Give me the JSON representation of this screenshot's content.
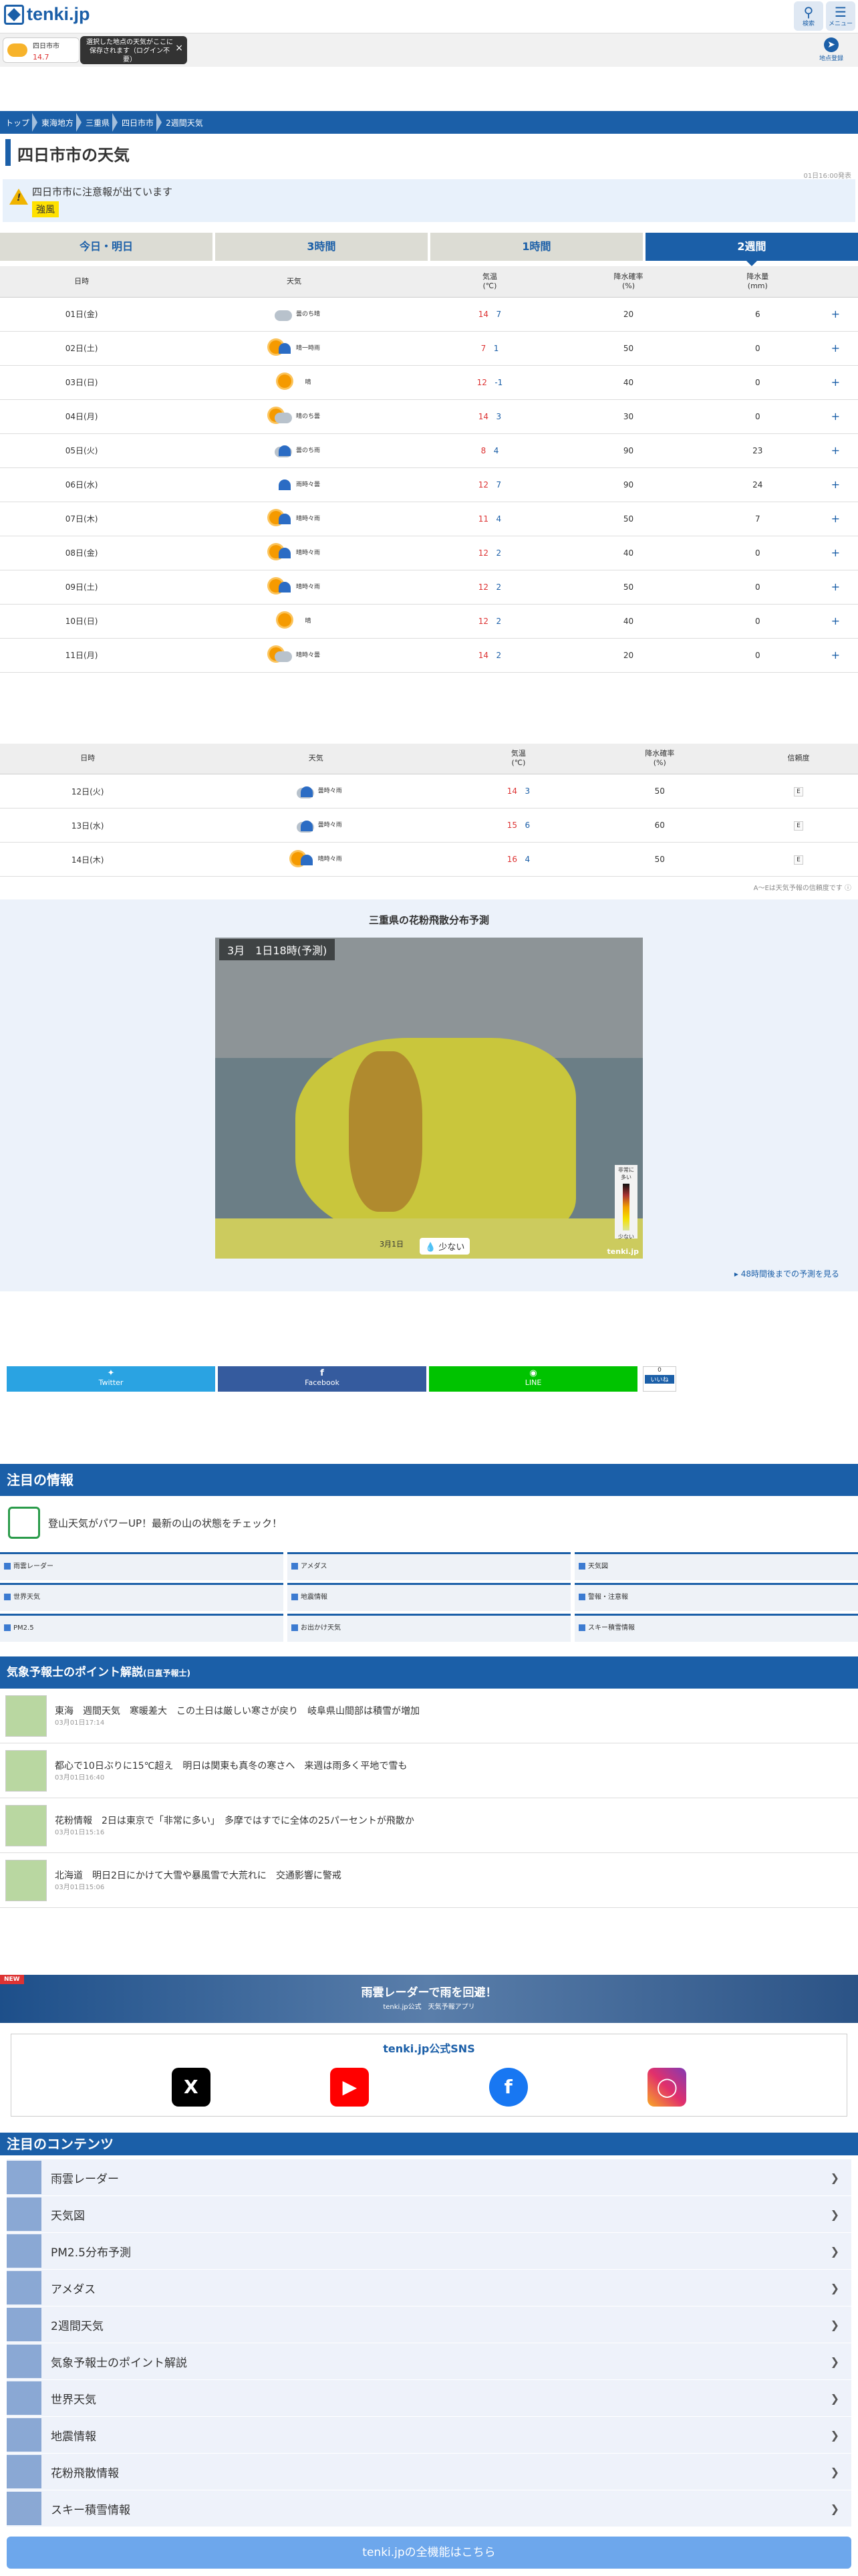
{
  "header": {
    "logo": "tenki.jp",
    "search": "検索",
    "menu": "メニュー"
  },
  "current": {
    "place": "四日市市",
    "temp": "14.7",
    "tooltip": "選択した地点の天気がここに保存されます（ログイン不要）",
    "close": "×",
    "register": "地点登録"
  },
  "breadcrumb": [
    "トップ",
    "東海地方",
    "三重県",
    "四日市市",
    "2週間天気"
  ],
  "title": "四日市市の天気",
  "published": "01日16:00発表",
  "warning": {
    "text": "四日市市に注意報が出ています",
    "keyword": "強風"
  },
  "tabs": [
    "今日・明日",
    "3時間",
    "1時間",
    "2週間"
  ],
  "table1": {
    "headers": [
      "日時",
      "天気",
      "気温\n(℃)",
      "降水確率\n(%)",
      "降水量\n(mm)"
    ],
    "rows": [
      {
        "date": "01日(金)",
        "weather": "曇のち晴",
        "hi": "14",
        "lo": "7",
        "pop": "20",
        "rain": "6",
        "icon": "cloudy-sun-icon"
      },
      {
        "date": "02日(土)",
        "weather": "晴一時雨",
        "hi": "7",
        "lo": "1",
        "pop": "50",
        "rain": "0",
        "icon": "sun-rain-icon"
      },
      {
        "date": "03日(日)",
        "weather": "晴",
        "hi": "12",
        "lo": "-1",
        "pop": "40",
        "rain": "0",
        "icon": "sun-icon"
      },
      {
        "date": "04日(月)",
        "weather": "晴のち曇",
        "hi": "14",
        "lo": "3",
        "pop": "30",
        "rain": "0",
        "icon": "sun-cloud-icon"
      },
      {
        "date": "05日(火)",
        "weather": "曇のち雨",
        "hi": "8",
        "lo": "4",
        "pop": "90",
        "rain": "23",
        "icon": "cloud-rain-icon"
      },
      {
        "date": "06日(水)",
        "weather": "雨時々曇",
        "hi": "12",
        "lo": "7",
        "pop": "90",
        "rain": "24",
        "icon": "rain-icon"
      },
      {
        "date": "07日(木)",
        "weather": "晴時々雨",
        "hi": "11",
        "lo": "4",
        "pop": "50",
        "rain": "7",
        "icon": "sun-rain-icon"
      },
      {
        "date": "08日(金)",
        "weather": "晴時々雨",
        "hi": "12",
        "lo": "2",
        "pop": "40",
        "rain": "0",
        "icon": "sun-rain-icon"
      },
      {
        "date": "09日(土)",
        "weather": "晴時々雨",
        "hi": "12",
        "lo": "2",
        "pop": "50",
        "rain": "0",
        "icon": "sun-rain-icon"
      },
      {
        "date": "10日(日)",
        "weather": "晴",
        "hi": "12",
        "lo": "2",
        "pop": "40",
        "rain": "0",
        "icon": "sun-icon"
      },
      {
        "date": "11日(月)",
        "weather": "晴時々曇",
        "hi": "14",
        "lo": "2",
        "pop": "20",
        "rain": "0",
        "icon": "sun-cloud-icon"
      }
    ]
  },
  "table2": {
    "headers": [
      "日時",
      "天気",
      "気温\n(℃)",
      "降水確率\n(%)",
      "信頼度"
    ],
    "rows": [
      {
        "date": "12日(火)",
        "weather": "曇時々雨",
        "hi": "14",
        "lo": "3",
        "pop": "50",
        "conf": "E"
      },
      {
        "date": "13日(水)",
        "weather": "曇時々雨",
        "hi": "15",
        "lo": "6",
        "pop": "60",
        "conf": "E"
      },
      {
        "date": "14日(木)",
        "weather": "晴時々雨",
        "hi": "16",
        "lo": "4",
        "pop": "50",
        "conf": "E"
      }
    ]
  },
  "reliability_note": "A〜Eは天気予報の信頼度です",
  "pollen": {
    "title": "三重県の花粉飛散分布予測",
    "label": "3月　1日18時(予測)",
    "date": "3月1日",
    "level": "少ない",
    "legend_top": "非常に多い",
    "legend_bottom": "少ない",
    "watermark": "tenki.jp",
    "more": "48時間後までの予測を見る"
  },
  "share": {
    "twitter": "Twitter",
    "facebook": "Facebook",
    "line": "LINE",
    "like": "0",
    "like_label": "いいね"
  },
  "attention": {
    "title": "注目の情報",
    "notice": "登山天気がパワーUP！最新の山の状態をチェック！"
  },
  "grid": [
    "雨雲レーダー",
    "アメダス",
    "天気図",
    "世界天気",
    "地震情報",
    "警報・注意報",
    "PM2.5",
    "お出かけ天気",
    "スキー積雪情報"
  ],
  "points": {
    "title": "気象予報士のポイント解説",
    "sub": "(日直予報士)",
    "items": [
      {
        "text": "東海　週間天気　寒暖差大　この土日は厳しい寒さが戻り　岐阜県山間部は積雪が増加",
        "time": "03月01日17:14"
      },
      {
        "text": "都心で10日ぶりに15℃超え　明日は関東も真冬の寒さへ　来週は雨多く平地で雪も",
        "time": "03月01日16:40"
      },
      {
        "text": "花粉情報　2日は東京で「非常に多い」　多摩ではすでに全体の25パーセントが飛散か",
        "time": "03月01日15:16"
      },
      {
        "text": "北海道　明日2日にかけて大雪や暴風雪で大荒れに　交通影響に警戒",
        "time": "03月01日15:06"
      }
    ]
  },
  "banner": {
    "new": "NEW",
    "title": "雨雲レーダーで雨を回避！",
    "sub": "tenki.jp公式　天気予報アプリ"
  },
  "sns": {
    "title": "tenki.jp公式SNS"
  },
  "contents": {
    "title": "注目のコンテンツ",
    "items": [
      "雨雲レーダー",
      "天気図",
      "PM2.5分布予測",
      "アメダス",
      "2週間天気",
      "気象予報士のポイント解説",
      "世界天気",
      "地震情報",
      "花粉飛散情報",
      "スキー積雪情報"
    ]
  },
  "footer": {
    "all": "tenki.jpの全機能はこちら"
  }
}
